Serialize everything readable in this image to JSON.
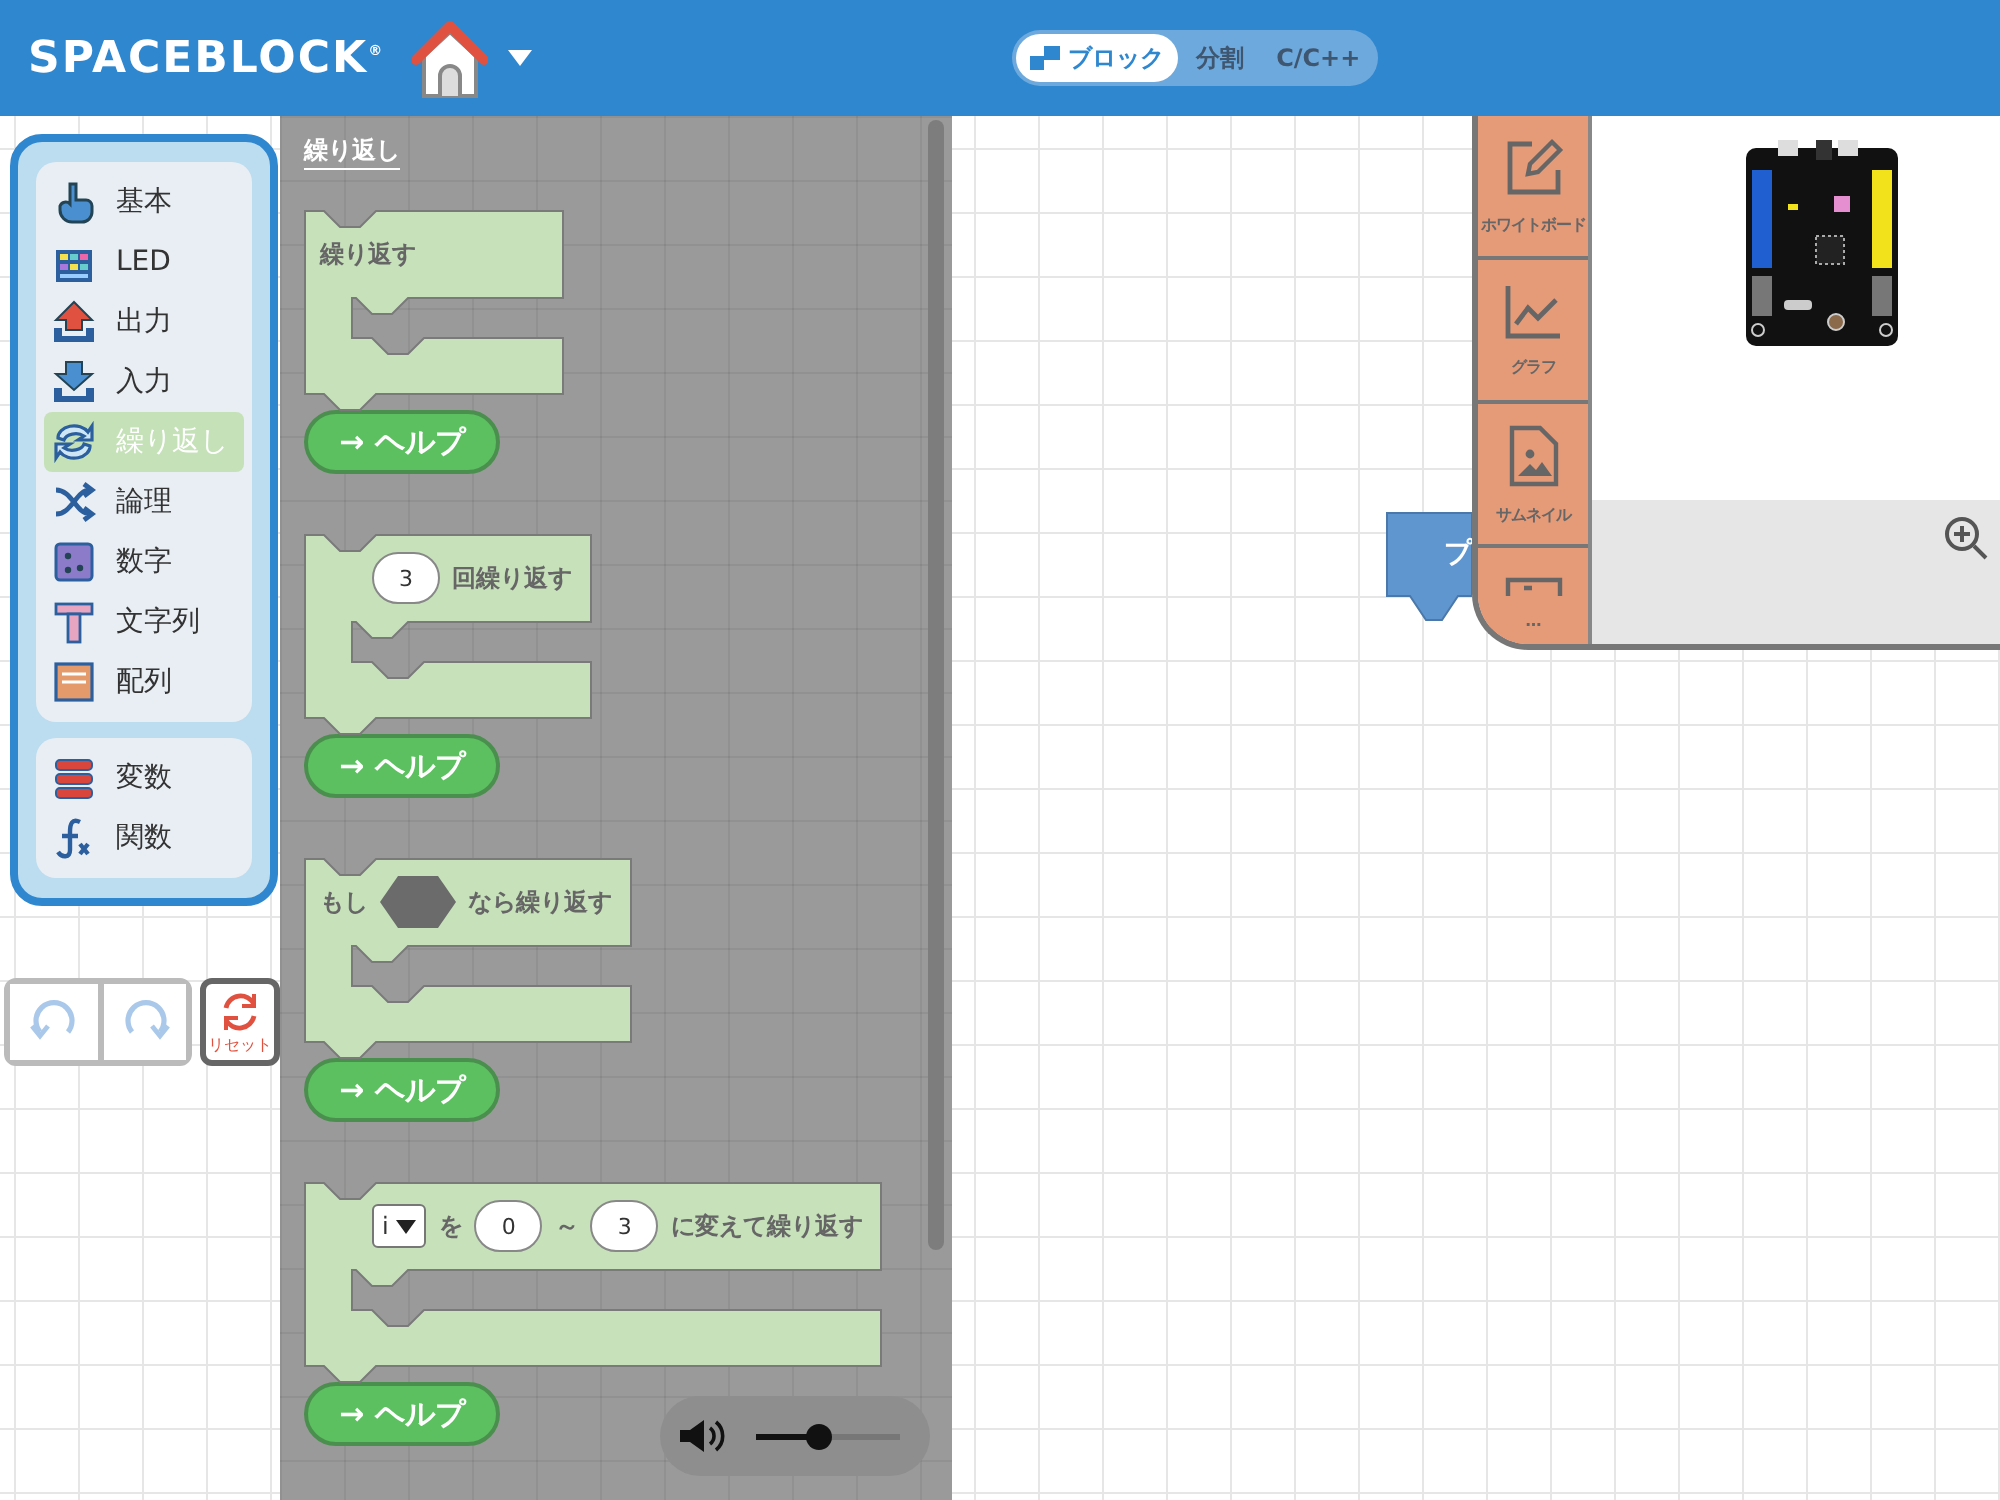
{
  "header": {
    "logo": "SPACEBLOCK$^{®}$",
    "mode_tabs": [
      {
        "label": "ブロック",
        "selected": true
      },
      {
        "label": "分割",
        "selected": false
      },
      {
        "label": "C/C++",
        "selected": false
      }
    ]
  },
  "toolbox": {
    "groups": [
      {
        "items": [
          {
            "label": "基本",
            "selected": false
          },
          {
            "label": "LED",
            "selected": false
          },
          {
            "label": "出力",
            "selected": false
          },
          {
            "label": "入力",
            "selected": false
          },
          {
            "label": "繰り返し",
            "selected": true
          },
          {
            "label": "論理",
            "selected": false
          },
          {
            "label": "数字",
            "selected": false
          },
          {
            "label": "文字列",
            "selected": false
          },
          {
            "label": "配列",
            "selected": false
          }
        ]
      },
      {
        "items": [
          {
            "label": "変数",
            "selected": false
          },
          {
            "label": "関数",
            "selected": false
          }
        ]
      }
    ]
  },
  "history": {
    "reset_label": "リセット"
  },
  "flyout": {
    "title": "繰り返し",
    "blocks": [
      {
        "parts": [
          {
            "kind": "text",
            "text": "繰り返す"
          }
        ],
        "help": "→ ヘルプ"
      },
      {
        "parts": [
          {
            "kind": "number",
            "value": "3"
          },
          {
            "kind": "text",
            "text": "回繰り返す"
          }
        ],
        "help": "→ ヘルプ"
      },
      {
        "parts": [
          {
            "kind": "text",
            "text": "もし"
          },
          {
            "kind": "hexagon"
          },
          {
            "kind": "text",
            "text": "なら繰り返す"
          }
        ],
        "help": "→ ヘルプ"
      },
      {
        "parts": [
          {
            "kind": "dropdown",
            "value": "i"
          },
          {
            "kind": "text",
            "text": "を"
          },
          {
            "kind": "number",
            "value": "0"
          },
          {
            "kind": "text",
            "text": "～"
          },
          {
            "kind": "number",
            "value": "3"
          },
          {
            "kind": "text",
            "text": "に変えて繰り返す"
          }
        ],
        "help": "→ ヘルプ"
      }
    ]
  },
  "volume": {
    "level": 0.43
  },
  "canvas_block": {
    "text": "プ"
  },
  "side_tabs": [
    {
      "label": "ホワイトボード"
    },
    {
      "label": "グラフ"
    },
    {
      "label": "サムネイル"
    },
    {
      "label": "…"
    }
  ]
}
